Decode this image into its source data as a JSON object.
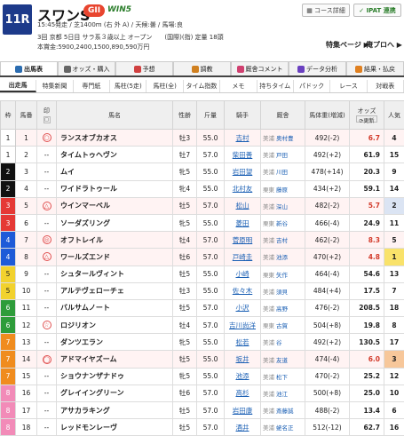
{
  "race": {
    "number": "11R",
    "name": "スワンS",
    "grade": "GII",
    "win5": "WIN5",
    "meta1": "15:45発走 / 芝1400m (右 外 A) / 天候:曇 / 馬場:良",
    "meta2": "3回 京都 5日目 サラ系３歳以上 オープン　　(国際)(指) 定量 18頭",
    "meta3": "本賞金:5900,2400,1500,890,590万円"
  },
  "buttons": {
    "course": "コース詳細",
    "ipat": "IPAT 連携"
  },
  "links": {
    "special": "特集ページ ▶",
    "prediction": "俺プロへ ▶"
  },
  "tabs": [
    {
      "label": "出馬表",
      "color": "#2b6cb0"
    },
    {
      "label": "オッズ・購入",
      "color": "#666"
    },
    {
      "label": "予想",
      "color": "#d04040"
    },
    {
      "label": "調教",
      "color": "#d08020"
    },
    {
      "label": "厩舎コメント",
      "color": "#d04070"
    },
    {
      "label": "データ分析",
      "color": "#6a40c0"
    },
    {
      "label": "結果・払戻",
      "color": "#e08020"
    }
  ],
  "subtabs": [
    "出走馬",
    "特集新聞",
    "専門紙",
    "馬柱(5走)",
    "馬柱(全)",
    "タイム指数",
    "メモ",
    "持ちタイム",
    "パドック",
    "レース",
    "対戦表"
  ],
  "columns": {
    "waku": "枠",
    "umaban": "馬番",
    "mark": "印",
    "name": "馬名",
    "sexage": "性齢",
    "weight": "斤量",
    "jockey": "騎手",
    "trainer": "厩舎",
    "body": "馬体重(増減)",
    "odds": "オッズ",
    "update": "更新",
    "pop": "人気"
  },
  "waku_colors": {
    "1": "#ffffff",
    "2": "#111111",
    "3": "#e53935",
    "4": "#1e5bd8",
    "5": "#f2d22e",
    "6": "#2e9c3a",
    "7": "#f08c1e",
    "8": "#f28bb8"
  },
  "horses": [
    {
      "waku": "1",
      "umaban": "1",
      "name": "ランスオブカオス",
      "sexage": "牡3",
      "weight": "55.0",
      "jockey": "吉村",
      "region": "美浦",
      "trainer": "奥村豊",
      "body": "492(-2)",
      "odds": "6.7",
      "hot": true,
      "pop": "4",
      "mark": "○"
    },
    {
      "waku": "1",
      "umaban": "2",
      "name": "タイムトゥヘヴン",
      "sexage": "牡7",
      "weight": "57.0",
      "jockey": "柴田善",
      "region": "美浦",
      "trainer": "戸田",
      "body": "492(+2)",
      "odds": "61.9",
      "hot": false,
      "pop": "15",
      "mark": "--"
    },
    {
      "waku": "2",
      "umaban": "3",
      "name": "ムイ",
      "sexage": "牝5",
      "weight": "55.0",
      "jockey": "岩田望",
      "region": "美浦",
      "trainer": "川田",
      "body": "478(+14)",
      "odds": "20.3",
      "hot": false,
      "pop": "9",
      "mark": "--"
    },
    {
      "waku": "2",
      "umaban": "4",
      "name": "ワイドラトゥール",
      "sexage": "牝4",
      "weight": "55.0",
      "jockey": "北村友",
      "region": "栗東",
      "trainer": "藤原",
      "body": "434(+2)",
      "odds": "59.1",
      "hot": false,
      "pop": "14",
      "mark": "--"
    },
    {
      "waku": "3",
      "umaban": "5",
      "name": "ウインマーベル",
      "sexage": "牡5",
      "weight": "57.0",
      "jockey": "松山",
      "region": "美浦",
      "trainer": "深山",
      "body": "482(-2)",
      "odds": "5.7",
      "hot": true,
      "pop": "2",
      "mark": "△"
    },
    {
      "waku": "3",
      "umaban": "6",
      "name": "ソーダズリング",
      "sexage": "牝5",
      "weight": "55.0",
      "jockey": "菱田",
      "region": "栗東",
      "trainer": "新谷",
      "body": "466(-4)",
      "odds": "24.9",
      "hot": false,
      "pop": "11",
      "mark": "--"
    },
    {
      "waku": "4",
      "umaban": "7",
      "name": "オフトレイル",
      "sexage": "牡4",
      "weight": "57.0",
      "jockey": "菅原明",
      "region": "美浦",
      "trainer": "吉村",
      "body": "462(-2)",
      "odds": "8.3",
      "hot": true,
      "pop": "5",
      "mark": "◎"
    },
    {
      "waku": "4",
      "umaban": "8",
      "name": "ワールズエンド",
      "sexage": "牡6",
      "weight": "57.0",
      "jockey": "戸崎圭",
      "region": "美浦",
      "trainer": "池添",
      "body": "470(+2)",
      "odds": "4.8",
      "hot": true,
      "pop": "1",
      "mark": "△"
    },
    {
      "waku": "5",
      "umaban": "9",
      "name": "シュタールヴィント",
      "sexage": "牡5",
      "weight": "55.0",
      "jockey": "小崎",
      "region": "栗東",
      "trainer": "矢作",
      "body": "464(-4)",
      "odds": "54.6",
      "hot": false,
      "pop": "13",
      "mark": "--"
    },
    {
      "waku": "5",
      "umaban": "10",
      "name": "アルテヴェローチェ",
      "sexage": "牡3",
      "weight": "55.0",
      "jockey": "佐々木",
      "region": "美浦",
      "trainer": "須貝",
      "body": "484(+4)",
      "odds": "17.5",
      "hot": false,
      "pop": "7",
      "mark": "--"
    },
    {
      "waku": "6",
      "umaban": "11",
      "name": "バルサムノート",
      "sexage": "牡5",
      "weight": "57.0",
      "jockey": "小沢",
      "region": "美浦",
      "trainer": "高野",
      "body": "476(-2)",
      "odds": "208.5",
      "hot": false,
      "pop": "18",
      "mark": "--"
    },
    {
      "waku": "6",
      "umaban": "12",
      "name": "ロジリオン",
      "sexage": "牡4",
      "weight": "57.0",
      "jockey": "吉川尚洋",
      "region": "栗東",
      "trainer": "古賀",
      "body": "504(+8)",
      "odds": "19.8",
      "hot": false,
      "pop": "8",
      "mark": "☆"
    },
    {
      "waku": "7",
      "umaban": "13",
      "name": "ダンツエラン",
      "sexage": "牝5",
      "weight": "55.0",
      "jockey": "松若",
      "region": "美浦",
      "trainer": "谷",
      "body": "492(+2)",
      "odds": "130.5",
      "hot": false,
      "pop": "17",
      "mark": "--"
    },
    {
      "waku": "7",
      "umaban": "14",
      "name": "アドマイヤズーム",
      "sexage": "牡5",
      "weight": "55.0",
      "jockey": "坂井",
      "region": "美浦",
      "trainer": "友道",
      "body": "474(-4)",
      "odds": "6.0",
      "hot": true,
      "pop": "3",
      "mark": "◯"
    },
    {
      "waku": "7",
      "umaban": "15",
      "name": "ショウナンザナドゥ",
      "sexage": "牝5",
      "weight": "55.0",
      "jockey": "池添",
      "region": "美浦",
      "trainer": "松下",
      "body": "470(-2)",
      "odds": "25.2",
      "hot": false,
      "pop": "12",
      "mark": "--"
    },
    {
      "waku": "8",
      "umaban": "16",
      "name": "グレイイングリーン",
      "sexage": "牡6",
      "weight": "57.0",
      "jockey": "高杉",
      "region": "美浦",
      "trainer": "池江",
      "body": "500(+8)",
      "odds": "25.0",
      "hot": false,
      "pop": "10",
      "mark": "--"
    },
    {
      "waku": "8",
      "umaban": "17",
      "name": "アサカラキング",
      "sexage": "牡5",
      "weight": "57.0",
      "jockey": "岩田康",
      "region": "美浦",
      "trainer": "斎藤誠",
      "body": "488(-2)",
      "odds": "13.4",
      "hot": false,
      "pop": "6",
      "mark": "--"
    },
    {
      "waku": "8",
      "umaban": "18",
      "name": "レッドモンレーヴ",
      "sexage": "牡5",
      "weight": "57.0",
      "jockey": "酒井",
      "region": "美浦",
      "trainer": "蛯名正",
      "body": "512(-12)",
      "odds": "62.7",
      "hot": false,
      "pop": "16",
      "mark": "--"
    }
  ]
}
